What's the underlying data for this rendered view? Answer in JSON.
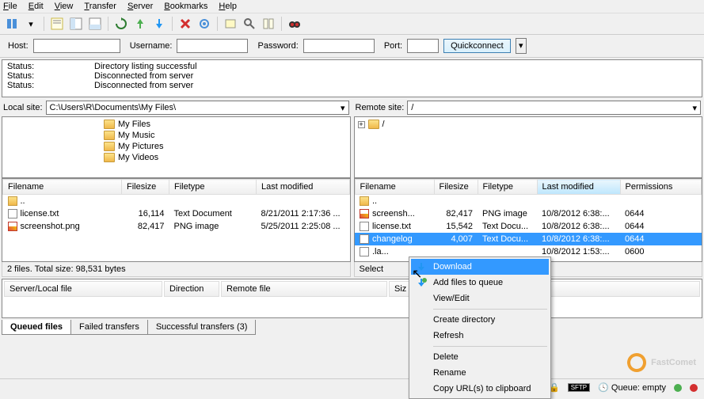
{
  "menu": [
    "File",
    "Edit",
    "View",
    "Transfer",
    "Server",
    "Bookmarks",
    "Help"
  ],
  "quickconnect": {
    "host_label": "Host:",
    "username_label": "Username:",
    "password_label": "Password:",
    "port_label": "Port:",
    "button": "Quickconnect"
  },
  "status_log": [
    {
      "label": "Status:",
      "msg": "Directory listing successful"
    },
    {
      "label": "Status:",
      "msg": "Disconnected from server"
    },
    {
      "label": "Status:",
      "msg": "Disconnected from server"
    }
  ],
  "local": {
    "path_label": "Local site:",
    "path": "C:\\Users\\R\\Documents\\My Files\\",
    "tree": [
      "My Files",
      "My Music",
      "My Pictures",
      "My Videos"
    ],
    "columns": [
      "Filename",
      "Filesize",
      "Filetype",
      "Last modified"
    ],
    "rows": [
      {
        "icon": "folder",
        "name": "..",
        "size": "",
        "type": "",
        "mod": ""
      },
      {
        "icon": "txt",
        "name": "license.txt",
        "size": "16,114",
        "type": "Text Document",
        "mod": "8/21/2011 2:17:36 ..."
      },
      {
        "icon": "png",
        "name": "screenshot.png",
        "size": "82,417",
        "type": "PNG image",
        "mod": "5/25/2011 2:25:08 ..."
      }
    ],
    "summary": "2 files. Total size: 98,531 bytes"
  },
  "remote": {
    "path_label": "Remote site:",
    "path": "/",
    "tree_root": "/",
    "columns": [
      "Filename",
      "Filesize",
      "Filetype",
      "Last modified",
      "Permissions"
    ],
    "rows": [
      {
        "icon": "folder",
        "name": "..",
        "size": "",
        "type": "",
        "mod": "",
        "perm": ""
      },
      {
        "icon": "png",
        "name": "screensh...",
        "size": "82,417",
        "type": "PNG image",
        "mod": "10/8/2012 6:38:...",
        "perm": "0644"
      },
      {
        "icon": "txt",
        "name": "license.txt",
        "size": "15,542",
        "type": "Text Docu...",
        "mod": "10/8/2012 6:38:...",
        "perm": "0644"
      },
      {
        "icon": "txt",
        "name": "changelog",
        "size": "4,007",
        "type": "Text Docu...",
        "mod": "10/8/2012 6:38:...",
        "perm": "0644",
        "selected": true
      },
      {
        "icon": "txt",
        "name": ".la...",
        "size": "",
        "type": "",
        "mod": "10/8/2012 1:53:...",
        "perm": "0600"
      }
    ],
    "summary": "Select"
  },
  "queue": {
    "columns": [
      "Server/Local file",
      "Direction",
      "Remote file",
      "Siz"
    ],
    "tabs": [
      "Queued files",
      "Failed transfers",
      "Successful transfers (3)"
    ]
  },
  "context_menu": {
    "items": [
      "Download",
      "Add files to queue",
      "View/Edit",
      "Create directory",
      "Refresh",
      "Delete",
      "Rename",
      "Copy URL(s) to clipboard"
    ],
    "highlighted": 0,
    "separators_after": [
      2,
      4
    ]
  },
  "statusbar": {
    "queue": "Queue: empty"
  },
  "watermark": "FastComet"
}
